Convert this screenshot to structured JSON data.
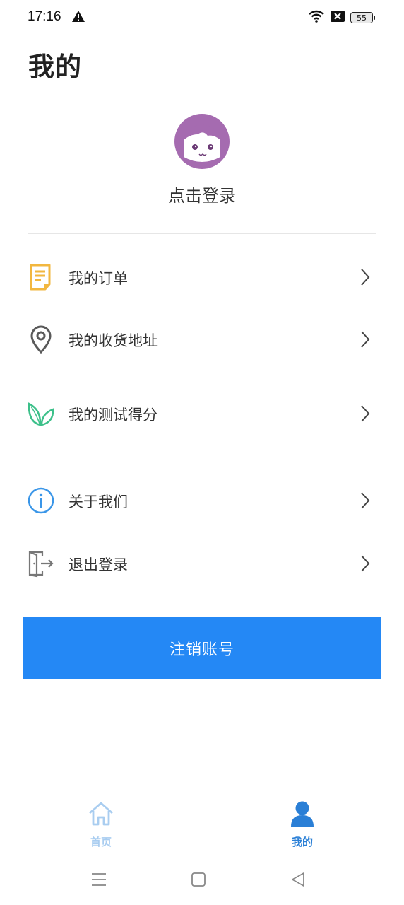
{
  "status_bar": {
    "time": "17:16",
    "battery": "55",
    "icons": [
      "warning-icon",
      "wifi-icon",
      "notification-x-icon",
      "battery-icon"
    ]
  },
  "page": {
    "title": "我的"
  },
  "profile": {
    "login_prompt": "点击登录",
    "avatar_icon": "cartoon-girl-avatar"
  },
  "menu_group_1": [
    {
      "label": "我的订单",
      "icon": "order-list-icon",
      "color": "#f2b73f"
    },
    {
      "label": "我的收货地址",
      "icon": "location-pin-icon",
      "color": "#5a5a5a"
    },
    {
      "label": "我的测试得分",
      "icon": "leaves-icon",
      "color": "#3cc08a"
    }
  ],
  "menu_group_2": [
    {
      "label": "关于我们",
      "icon": "info-circle-icon",
      "color": "#3a96e8"
    },
    {
      "label": "退出登录",
      "icon": "logout-door-icon",
      "color": "#777777"
    }
  ],
  "actions": {
    "cancel_account": "注销账号",
    "button_color": "#2488f5"
  },
  "tabbar": {
    "items": [
      {
        "label": "首页",
        "icon": "home-icon",
        "active": false,
        "color": "#a9cdf0"
      },
      {
        "label": "我的",
        "icon": "user-icon",
        "active": true,
        "color": "#2a7fd6"
      }
    ]
  },
  "system_nav": {
    "buttons": [
      "menu-icon",
      "home-square-icon",
      "back-triangle-icon"
    ]
  }
}
